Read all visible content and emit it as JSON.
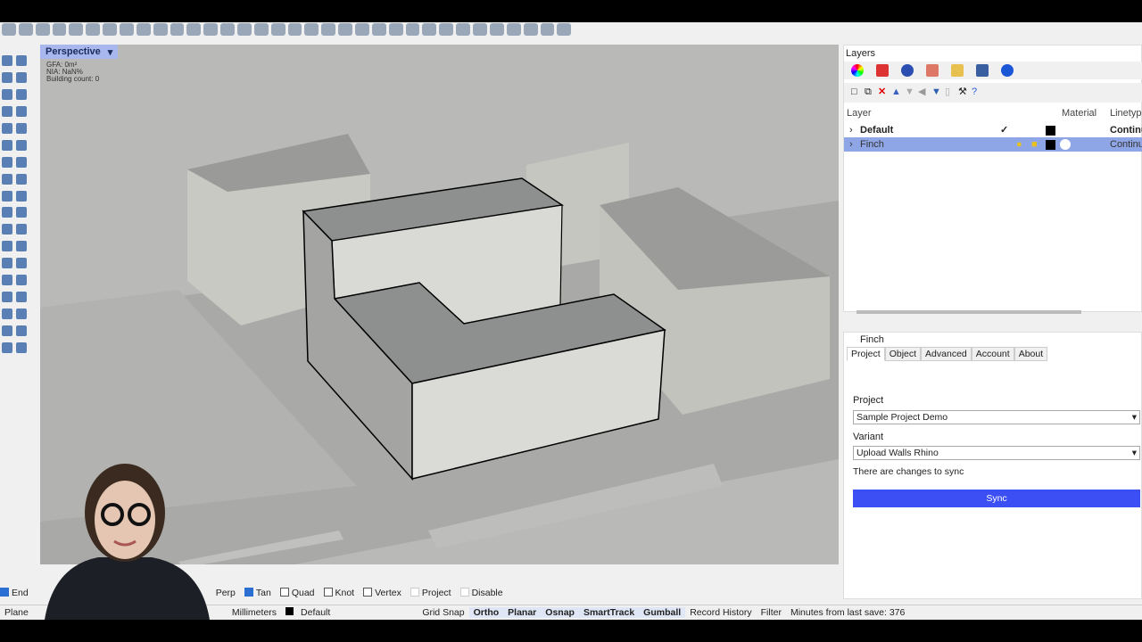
{
  "viewport": {
    "tab": "Perspective",
    "gfa": "GFA: 0m²",
    "nia": "NIA: NaN%",
    "count": "Building count: 0"
  },
  "layers": {
    "title": "Layers",
    "columns": {
      "layer": "Layer",
      "material": "Material",
      "linetype": "Linetype"
    },
    "rows": [
      {
        "name": "Default",
        "current": "✓",
        "linetype": "Continu"
      },
      {
        "name": "Finch",
        "linetype": "Continu",
        "selected": true
      }
    ]
  },
  "finch": {
    "title": "Finch",
    "tabs": [
      "Project",
      "Object",
      "Advanced",
      "Account",
      "About"
    ],
    "project_label": "Project",
    "project_value": "Sample Project Demo",
    "variant_label": "Variant",
    "variant_value": "Upload Walls Rhino",
    "changes": "There are changes to sync",
    "sync": "Sync"
  },
  "osnap": {
    "end": "End",
    "perp": "Perp",
    "tan": "Tan",
    "quad": "Quad",
    "knot": "Knot",
    "vertex": "Vertex",
    "project": "Project",
    "disable": "Disable"
  },
  "status": {
    "plane": "Plane",
    "units": "Millimeters",
    "layer": "Default",
    "grid": "Grid Snap",
    "ortho": "Ortho",
    "planar": "Planar",
    "osnap": "Osnap",
    "smart": "SmartTrack",
    "gumball": "Gumball",
    "history": "Record History",
    "filter": "Filter",
    "minutes": "Minutes from last save: 376"
  }
}
